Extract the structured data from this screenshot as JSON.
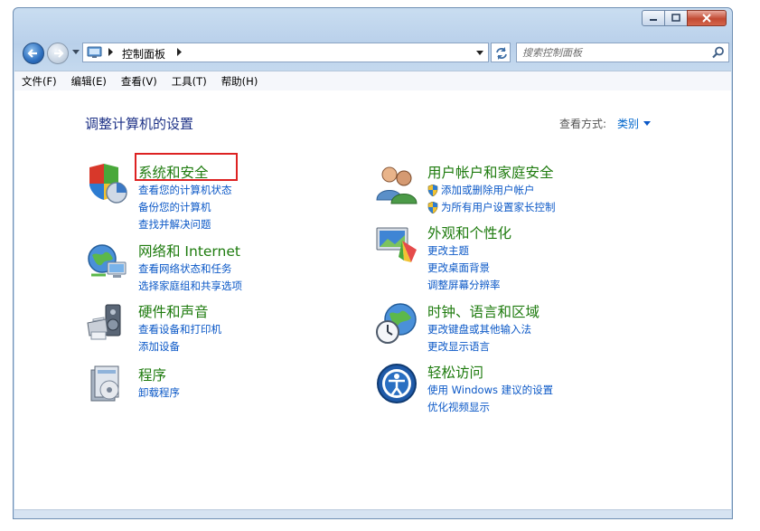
{
  "window": {
    "caption_buttons": [
      {
        "name": "minimize-icon"
      },
      {
        "name": "maximize-icon"
      },
      {
        "name": "close-icon"
      }
    ]
  },
  "navbar": {
    "breadcrumb": "控制面板",
    "search_placeholder": "搜索控制面板"
  },
  "menu": [
    "文件(F)",
    "编辑(E)",
    "查看(V)",
    "工具(T)",
    "帮助(H)"
  ],
  "page_title": "调整计算机的设置",
  "view_by": {
    "label": "查看方式:",
    "value": "类别"
  },
  "categories": {
    "system_security": {
      "title": "系统和安全",
      "links": [
        "查看您的计算机状态",
        "备份您的计算机",
        "查找并解决问题"
      ]
    },
    "network": {
      "title": "网络和 Internet",
      "links": [
        "查看网络状态和任务",
        "选择家庭组和共享选项"
      ]
    },
    "hardware": {
      "title": "硬件和声音",
      "links": [
        "查看设备和打印机",
        "添加设备"
      ]
    },
    "programs": {
      "title": "程序",
      "links": [
        "卸载程序"
      ]
    },
    "user_accounts": {
      "title": "用户帐户和家庭安全",
      "links": [
        "添加或删除用户帐户",
        "为所有用户设置家长控制"
      ]
    },
    "appearance": {
      "title": "外观和个性化",
      "links": [
        "更改主题",
        "更改桌面背景",
        "调整屏幕分辨率"
      ]
    },
    "clock_region": {
      "title": "时钟、语言和区域",
      "links": [
        "更改键盘或其他输入法",
        "更改显示语言"
      ]
    },
    "ease_access": {
      "title": "轻松访问",
      "links": [
        "使用 Windows 建议的设置",
        "优化视频显示"
      ]
    }
  },
  "colors": {
    "category_title": "#1e7b0e",
    "link": "#0b58c7",
    "page_title": "#1e3287",
    "highlight": "#dd2222"
  }
}
